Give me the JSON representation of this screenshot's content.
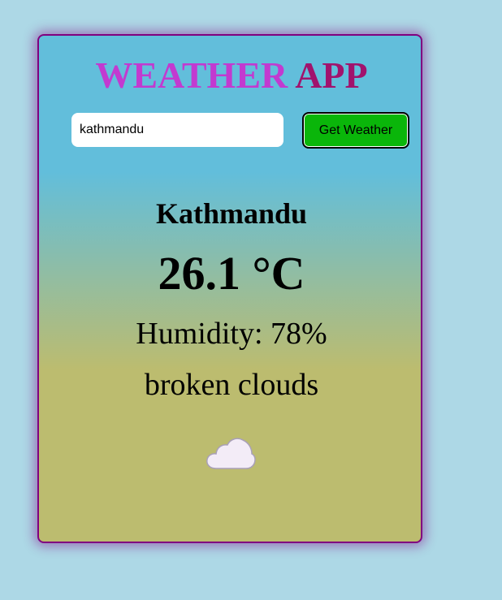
{
  "app": {
    "title_part1": "WEATHER",
    "title_part2": "APP"
  },
  "search": {
    "value": "kathmandu",
    "placeholder": "",
    "button_label": "Get Weather"
  },
  "weather": {
    "city": "Kathmandu",
    "temperature": "26.1 °C",
    "humidity": "Humidity: 78%",
    "description": "broken clouds",
    "icon": "cloud-icon"
  },
  "colors": {
    "page_background": "#add8e6",
    "card_border": "#800080",
    "title_part1": "#c23ad0",
    "title_part2": "#a1136d",
    "button_background": "#0ab60a",
    "gradient_top": "#62bedb",
    "gradient_bottom": "#bcbc6f"
  }
}
